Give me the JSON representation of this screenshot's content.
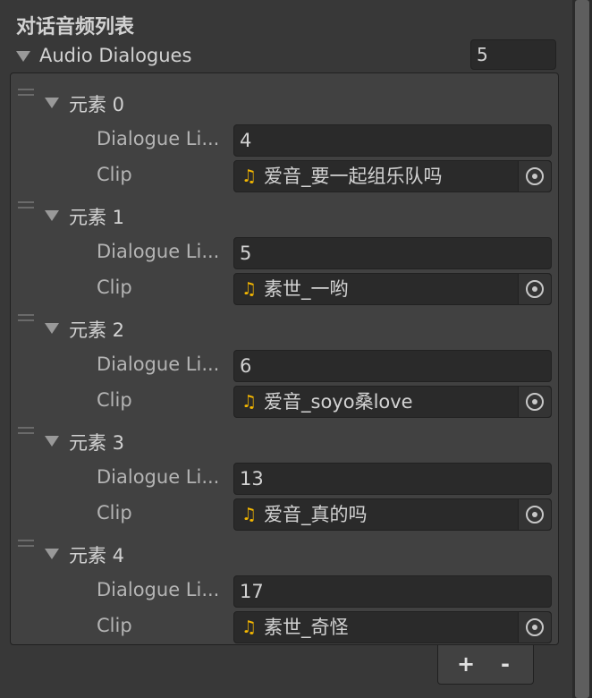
{
  "header": {
    "title": "对话音频列表"
  },
  "list": {
    "label": "Audio Dialogues",
    "size": "5",
    "elements": [
      {
        "label": "元素 0",
        "line_label": "Dialogue Li...",
        "line_value": "4",
        "clip_label": "Clip",
        "clip_name": "爱音_要一起组乐队吗"
      },
      {
        "label": "元素 1",
        "line_label": "Dialogue Li...",
        "line_value": "5",
        "clip_label": "Clip",
        "clip_name": "素世_一哟"
      },
      {
        "label": "元素 2",
        "line_label": "Dialogue Li...",
        "line_value": "6",
        "clip_label": "Clip",
        "clip_name": "爱音_soyo桑love"
      },
      {
        "label": "元素 3",
        "line_label": "Dialogue Li...",
        "line_value": "13",
        "clip_label": "Clip",
        "clip_name": "爱音_真的吗"
      },
      {
        "label": "元素 4",
        "line_label": "Dialogue Li...",
        "line_value": "17",
        "clip_label": "Clip",
        "clip_name": "素世_奇怪"
      }
    ]
  },
  "footer": {
    "add_label": "+",
    "remove_label": "-"
  },
  "icons": {
    "clip": "music-note-icon",
    "picker": "object-picker-icon",
    "handle": "drag-handle-icon",
    "foldout": "foldout-triangle-icon"
  },
  "colors": {
    "background": "#383838",
    "field": "#2a2a2a",
    "note": "#f5b700"
  }
}
